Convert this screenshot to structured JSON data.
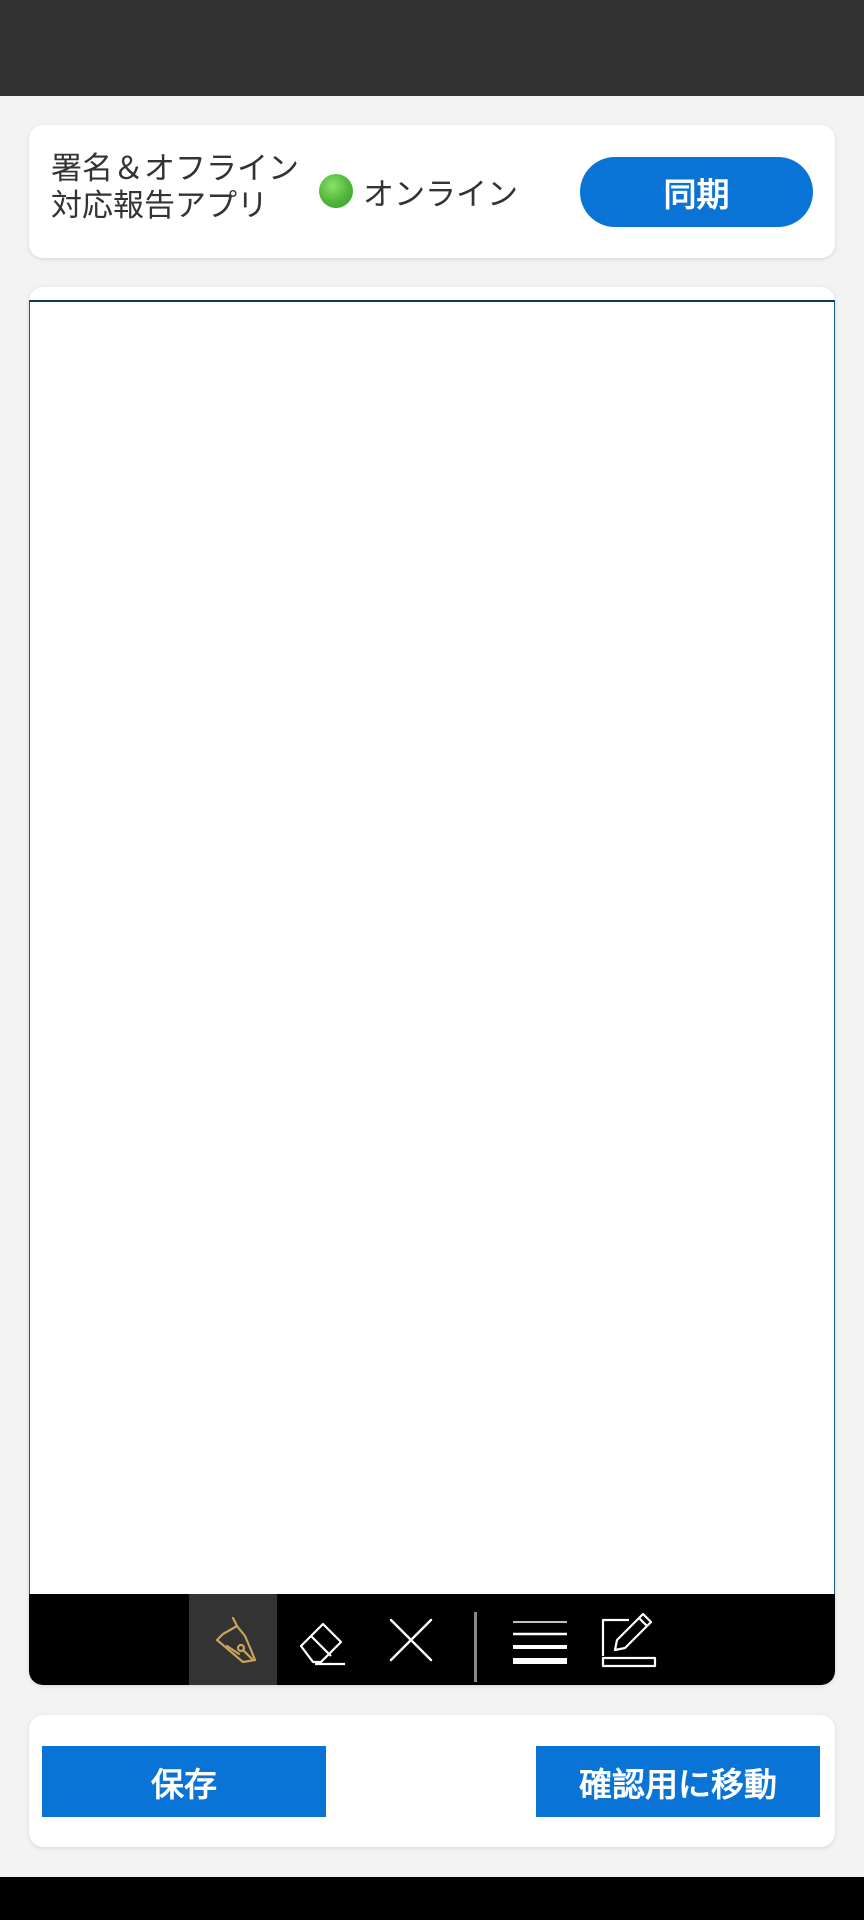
{
  "header": {
    "title": "署名＆オフライン対応報告アプリ",
    "status_icon": "green-circle",
    "status_text": "オンライン",
    "sync_label": "同期"
  },
  "toolbar": {
    "tools": [
      {
        "name": "pen",
        "icon": "pen-nib-icon",
        "active": true
      },
      {
        "name": "eraser",
        "icon": "eraser-icon",
        "active": false
      },
      {
        "name": "clear",
        "icon": "close-icon",
        "active": false
      },
      {
        "name": "stroke-width",
        "icon": "line-width-icon",
        "active": false
      },
      {
        "name": "edit",
        "icon": "edit-icon",
        "active": false
      }
    ],
    "active_color": "#c9a35a"
  },
  "footer": {
    "save_label": "保存",
    "confirm_label": "確認用に移動"
  },
  "colors": {
    "accent": "#0a74d6",
    "status_online": "#4fb53a"
  }
}
